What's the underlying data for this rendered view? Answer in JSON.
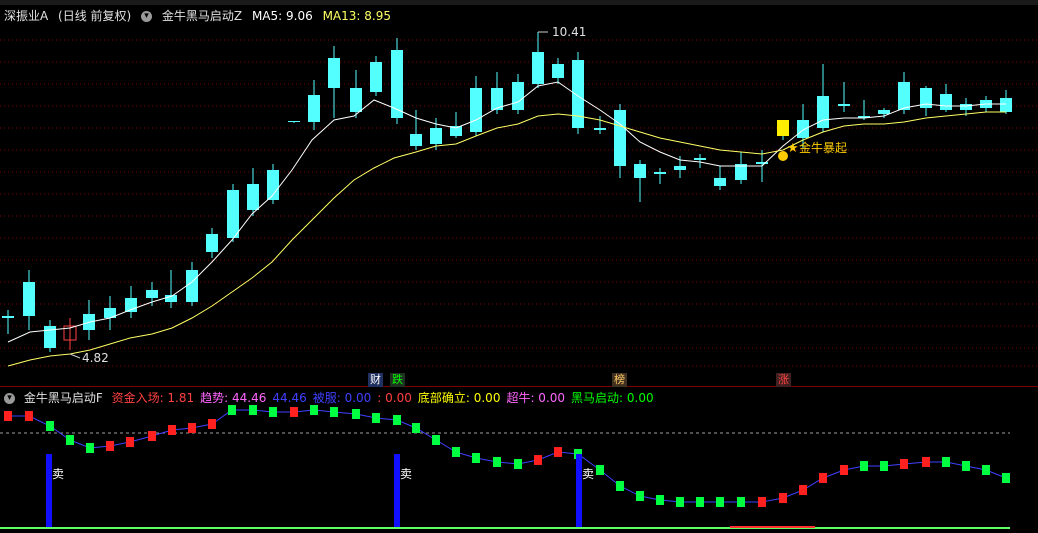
{
  "top_menu": {
    "visible": true
  },
  "header": {
    "stock": "深振业A",
    "period": "(日线 前复权)",
    "indicator": "金牛黑马启动Z",
    "ma5_label": "MA5: 9.06",
    "ma13_label": "MA13: 8.95"
  },
  "main_chart": {
    "high_label": "10.41",
    "low_label": "4.82",
    "signal_label": "金牛暴起",
    "star_icon": "star-icon",
    "colors": {
      "up": "#ff4040",
      "down": "#54ffff",
      "ma5": "#ffffff",
      "ma13": "#ffff66",
      "grid": "#800000"
    }
  },
  "event_tags": [
    {
      "label": "财",
      "color": "#ffffff",
      "bg": "#203060"
    },
    {
      "label": "跌",
      "color": "#00ff00",
      "bg": "#203020"
    },
    {
      "label": "榜",
      "color": "#ffcc66",
      "bg": "#403020"
    },
    {
      "label": "涨",
      "color": "#ff4040",
      "bg": "#402020"
    }
  ],
  "sub_chart": {
    "title": "金牛黑马启动F",
    "fields": [
      {
        "label": "资金入场: 1.81",
        "color": "#ff4040"
      },
      {
        "label": "趋势: 44.46",
        "color": "#ff66ff"
      },
      {
        "label": "44.46",
        "color": "#4040ff"
      },
      {
        "label": "被服: 0.00",
        "color": "#4040ff"
      },
      {
        "label": ": 0.00",
        "color": "#ff4040"
      },
      {
        "label": "底部确立: 0.00",
        "color": "#ffff00"
      },
      {
        "label": "超牛: 0.00",
        "color": "#ff66ff"
      },
      {
        "label": "黑马启动: 0.00",
        "color": "#00ff00"
      }
    ],
    "sell_label": "卖"
  }
}
